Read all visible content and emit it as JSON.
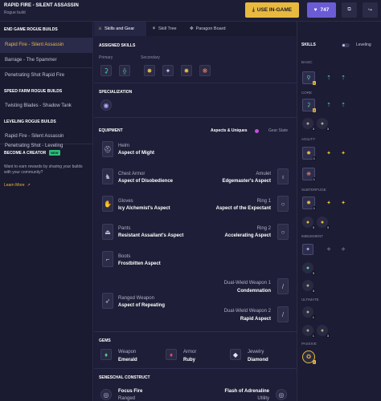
{
  "header": {
    "title": "RAPID FIRE - SILENT ASSASSIN",
    "subtitle": "Rogue build",
    "use_in_game": "USE IN-GAME",
    "votes": "747",
    "accent": "#e8b93f",
    "vote_color": "#6a5cd4"
  },
  "sidebar": {
    "groups": [
      {
        "heading": "END GAME ROGUE BUILDS",
        "items": [
          "Rapid Fire - Silent Assassin",
          "Barrage - The Spammer",
          "Penetrating Shot Rapid Fire"
        ]
      },
      {
        "heading": "SPEED FARM ROGUE BUILDS",
        "items": [
          "Twisting Blades - Shadow Tank"
        ]
      },
      {
        "heading": "LEVELING ROGUE BUILDS",
        "items": [
          "Rapid Fire - Silent Assassin",
          "Penetrating Shot - Leveling"
        ]
      }
    ],
    "creator": {
      "title": "BECOME A CREATOR",
      "badge": "NEW",
      "text": "Want to earn rewards by sharing your builds with your community?",
      "link": "Learn More"
    }
  },
  "tabs": [
    "Skills and Gear",
    "Skill Tree",
    "Paragon Board"
  ],
  "assigned_skills": {
    "heading": "ASSIGNED SKILLS",
    "primary_label": "Primary",
    "secondary_label": "Secondary"
  },
  "specialization": {
    "heading": "SPECIALIZATION"
  },
  "equipment": {
    "heading": "EQUIPMENT",
    "filters": {
      "aspects": "Aspects & Uniques",
      "gear": "Gear State"
    },
    "left": [
      {
        "type": "Helm",
        "aspect": "Aspect of Might"
      },
      {
        "type": "Chest Armor",
        "aspect": "Aspect of Disobedience"
      },
      {
        "type": "Gloves",
        "aspect": "Icy Alchemist's Aspect"
      },
      {
        "type": "Pants",
        "aspect": "Resistant Assailant's Aspect"
      },
      {
        "type": "Boots",
        "aspect": "Frostbitten Aspect"
      },
      {
        "type": "Ranged Weapon",
        "aspect": "Aspect of Repeating"
      }
    ],
    "right": [
      {
        "type": "Amulet",
        "aspect": "Edgemaster's Aspect"
      },
      {
        "type": "Ring 1",
        "aspect": "Aspect of the Expectant"
      },
      {
        "type": "Ring 2",
        "aspect": "Accelerating Aspect"
      },
      {
        "type": "Dual-Wield Weapon 1",
        "aspect": "Condemnation"
      },
      {
        "type": "Dual-Wield Weapon 2",
        "aspect": "Rapid Aspect"
      }
    ]
  },
  "gems": {
    "heading": "GEMS",
    "items": [
      {
        "type": "Weapon",
        "gem": "Emerald"
      },
      {
        "type": "Armor",
        "gem": "Ruby"
      },
      {
        "type": "Jewelry",
        "gem": "Diamond"
      }
    ]
  },
  "seneschal": {
    "heading": "SENESCHAL CONSTRUCT",
    "left_title": "Focus Fire",
    "left_sub": "Ranged",
    "right_title": "Flash of Adrenaline",
    "right_sub": "Utility"
  },
  "skills_panel": {
    "heading": "SKILLS",
    "toggle_label": "Leveling",
    "categories": [
      "BASIC",
      "CORE",
      "AGILITY",
      "SUBTERFUGE",
      "IMBUEMENT",
      "ULTIMATE",
      "PASSIVE"
    ],
    "counts": {
      "basic": "1",
      "core_main": "5",
      "core_a": "3",
      "core_b": "3",
      "agility_a": "1",
      "agility_b": "1",
      "subterfuge_main": "1",
      "subterfuge_a": "3",
      "subterfuge_b": "3",
      "imbuement_a": "3",
      "imbuement_b": "3",
      "ultimate_a": "1",
      "ultimate_b": "1",
      "ultimate_c": "3",
      "passive": "1"
    }
  }
}
